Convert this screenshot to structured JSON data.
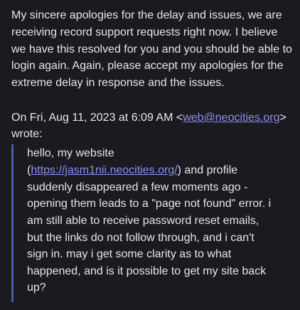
{
  "reply": {
    "lines": [
      "My sincere apologies for the delay and issues, we are",
      "receiving record support requests right now. I believe",
      "we have this resolved for you and you should be able to",
      "login again. Again, please accept my apologies for the",
      "extreme delay in response and the issues."
    ]
  },
  "attribution": {
    "prefix": "On Fri, Aug 11, 2023 at 6:09 AM <",
    "email": "web@neocities.org",
    "suffix": ">",
    "wrote": "wrote:"
  },
  "quote": {
    "line1": "hello, my website",
    "line2_open": "(",
    "link": "https://jasm1nii.neocities.org/",
    "line2_rest": ") and profile",
    "lines": [
      "suddenly disappeared a few moments ago -",
      "opening them leads to a \"page not found\" error. i",
      "am still able to receive password reset emails,",
      "but the links do not follow through, and i can't",
      "sign in. may i get some clarity as to what",
      "happened, and is it possible to get my site back",
      "up?"
    ]
  },
  "colors": {
    "background": "#1b1a20",
    "text": "#e6e6ea",
    "link": "#8d90ee",
    "quote_bar": "#5258a8"
  }
}
